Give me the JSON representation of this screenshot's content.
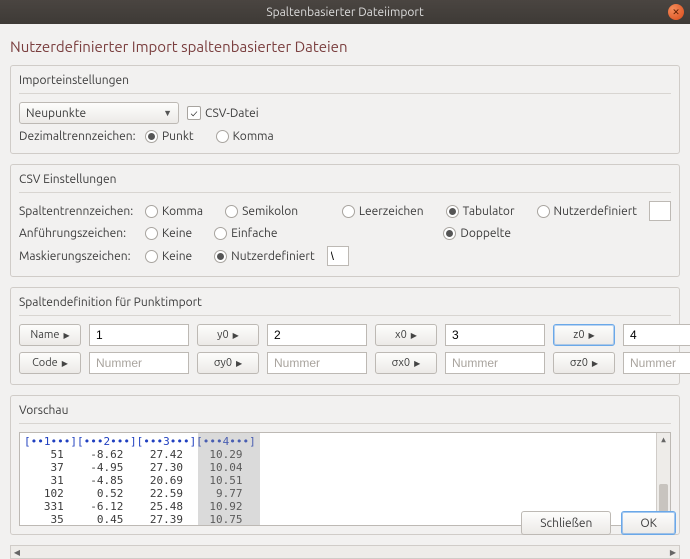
{
  "window": {
    "title": "Spaltenbasierter Dateiimport"
  },
  "header": "Nutzerdefinierter Import spaltenbasierter Dateien",
  "import": {
    "title": "Importeinstellungen",
    "type_selected": "Neupunkte",
    "csv_label": "CSV-Datei",
    "csv_checked": true,
    "decimal_label": "Dezimaltrennzeichen:",
    "decimal_options": {
      "punkt": "Punkt",
      "komma": "Komma"
    },
    "decimal_selected": "punkt"
  },
  "csv": {
    "title": "CSV Einstellungen",
    "sep_label": "Spaltentrennzeichen:",
    "sep_options": {
      "komma": "Komma",
      "semikolon": "Semikolon",
      "leer": "Leerzeichen",
      "tab": "Tabulator",
      "nutzer": "Nutzerdefiniert"
    },
    "sep_selected": "tab",
    "sep_custom": "",
    "quote_label": "Anführungszeichen:",
    "quote_options": {
      "keine": "Keine",
      "einfache": "Einfache",
      "doppelte": "Doppelte"
    },
    "quote_selected": "doppelte",
    "esc_label": "Maskierungszeichen:",
    "esc_options": {
      "keine": "Keine",
      "nutzer": "Nutzerdefiniert"
    },
    "esc_selected": "nutzer",
    "esc_custom": "\\"
  },
  "cols": {
    "title": "Spaltendefinition für Punktimport",
    "placeholder": "Nummer",
    "highlight": "z0",
    "defs": [
      {
        "key": "name",
        "label": "Name",
        "value": "1"
      },
      {
        "key": "y0",
        "label": "y0",
        "value": "2"
      },
      {
        "key": "x0",
        "label": "x0",
        "value": "3"
      },
      {
        "key": "z0",
        "label": "z0",
        "value": "4"
      },
      {
        "key": "code",
        "label": "Code",
        "value": ""
      },
      {
        "key": "sy0",
        "label": "σy0",
        "value": ""
      },
      {
        "key": "sx0",
        "label": "σx0",
        "value": ""
      },
      {
        "key": "sz0",
        "label": "σz0",
        "value": ""
      }
    ]
  },
  "preview": {
    "title": "Vorschau",
    "ruler": "[••1•••][•••2•••][•••3•••][•••4•••]",
    "lines": [
      "    51    -8.62    27.42    10.29",
      "    37    -4.95    27.30    10.04",
      "    31    -4.85    20.69    10.51",
      "   102     0.52    22.59     9.77",
      "   331    -6.12    25.48    10.92",
      "    35     0.45    27.39    10.75"
    ]
  },
  "footer": {
    "close": "Schließen",
    "ok": "OK"
  }
}
